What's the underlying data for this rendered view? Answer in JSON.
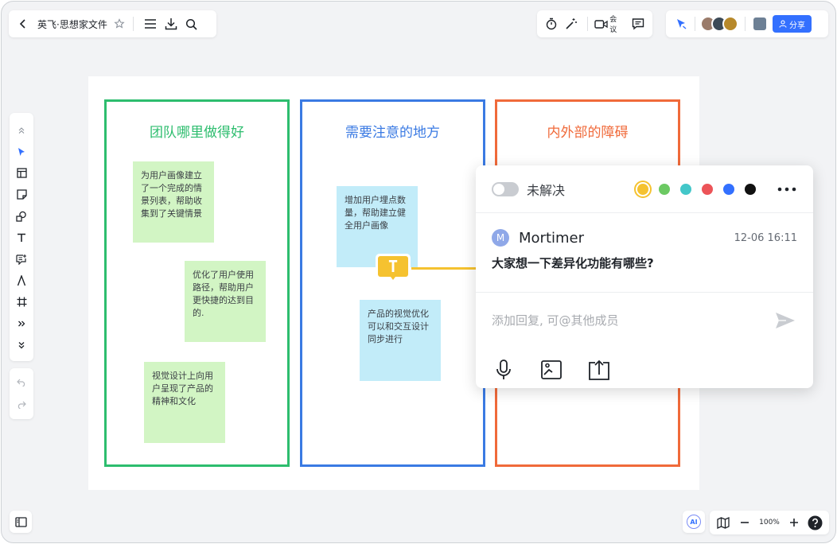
{
  "toolbar": {
    "doc_title": "英飞·思想家文件",
    "meeting_label": "会议",
    "share_label": "分享"
  },
  "board": {
    "frames": [
      {
        "title": "团队哪里做得好",
        "color": "#2dbd6e"
      },
      {
        "title": "需要注意的地方",
        "color": "#3a7ae3"
      },
      {
        "title": "内外部的障碍",
        "color": "#f06a3a"
      }
    ],
    "notes": [
      {
        "text": "为用户画像建立了一个完成的情景列表，帮助收集到了关键情景",
        "color": "green"
      },
      {
        "text": "优化了用户使用路径，帮助用户更快捷的达到目的.",
        "color": "green"
      },
      {
        "text": "视觉设计上向用户呈现了产品的精神和文化",
        "color": "green"
      },
      {
        "text": "增加用户埋点数量，帮助建立健全用户画像",
        "color": "blue"
      },
      {
        "text": "产品的视觉优化可以和交互设计同步进行",
        "color": "blue"
      }
    ],
    "text_marker": "T"
  },
  "comment": {
    "status": "未解决",
    "colors": [
      "#f5c230",
      "#6cc963",
      "#43c7c9",
      "#ec5458",
      "#3370ff",
      "#111111"
    ],
    "selected_color": "#f5c230",
    "author_initial": "M",
    "author": "Mortimer",
    "time": "12-06 16:11",
    "text": "大家想一下差异化功能有哪些?",
    "reply_placeholder": "添加回复, 可@其他成员"
  },
  "zoom": {
    "level": "100%"
  },
  "ai": {
    "label": "AI"
  }
}
